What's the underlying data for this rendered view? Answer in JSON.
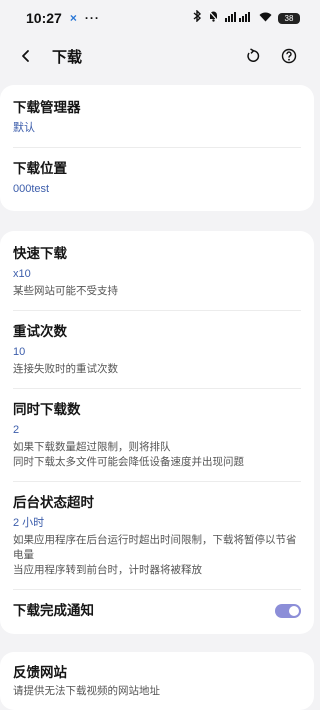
{
  "status_bar": {
    "time": "10:27",
    "x_label": "×",
    "dots": "···",
    "battery": "38"
  },
  "appbar": {
    "title": "下载"
  },
  "section1": {
    "items": [
      {
        "title": "下载管理器",
        "value": "默认"
      },
      {
        "title": "下载位置",
        "value": "000test"
      }
    ]
  },
  "section2": {
    "fast": {
      "title": "快速下载",
      "value": "x10",
      "desc": "某些网站可能不受支持"
    },
    "retry": {
      "title": "重试次数",
      "value": "10",
      "desc": "连接失败时的重试次数"
    },
    "concurrent": {
      "title": "同时下载数",
      "value": "2",
      "desc1": "如果下载数量超过限制，则将排队",
      "desc2": "同时下载太多文件可能会降低设备速度并出现问题"
    },
    "timeout": {
      "title": "后台状态超时",
      "value": "2 小时",
      "desc1": "如果应用程序在后台运行时超出时间限制，下载将暂停以节省电量",
      "desc2": "当应用程序转到前台时，计时器将被释放"
    },
    "notify": {
      "title": "下载完成通知",
      "enabled": true
    }
  },
  "section3": {
    "feedback": {
      "title": "反馈网站",
      "desc": "请提供无法下载视频的网站地址"
    }
  },
  "colors": {
    "accent": "#8c8ed8",
    "value": "#3c5dab"
  }
}
